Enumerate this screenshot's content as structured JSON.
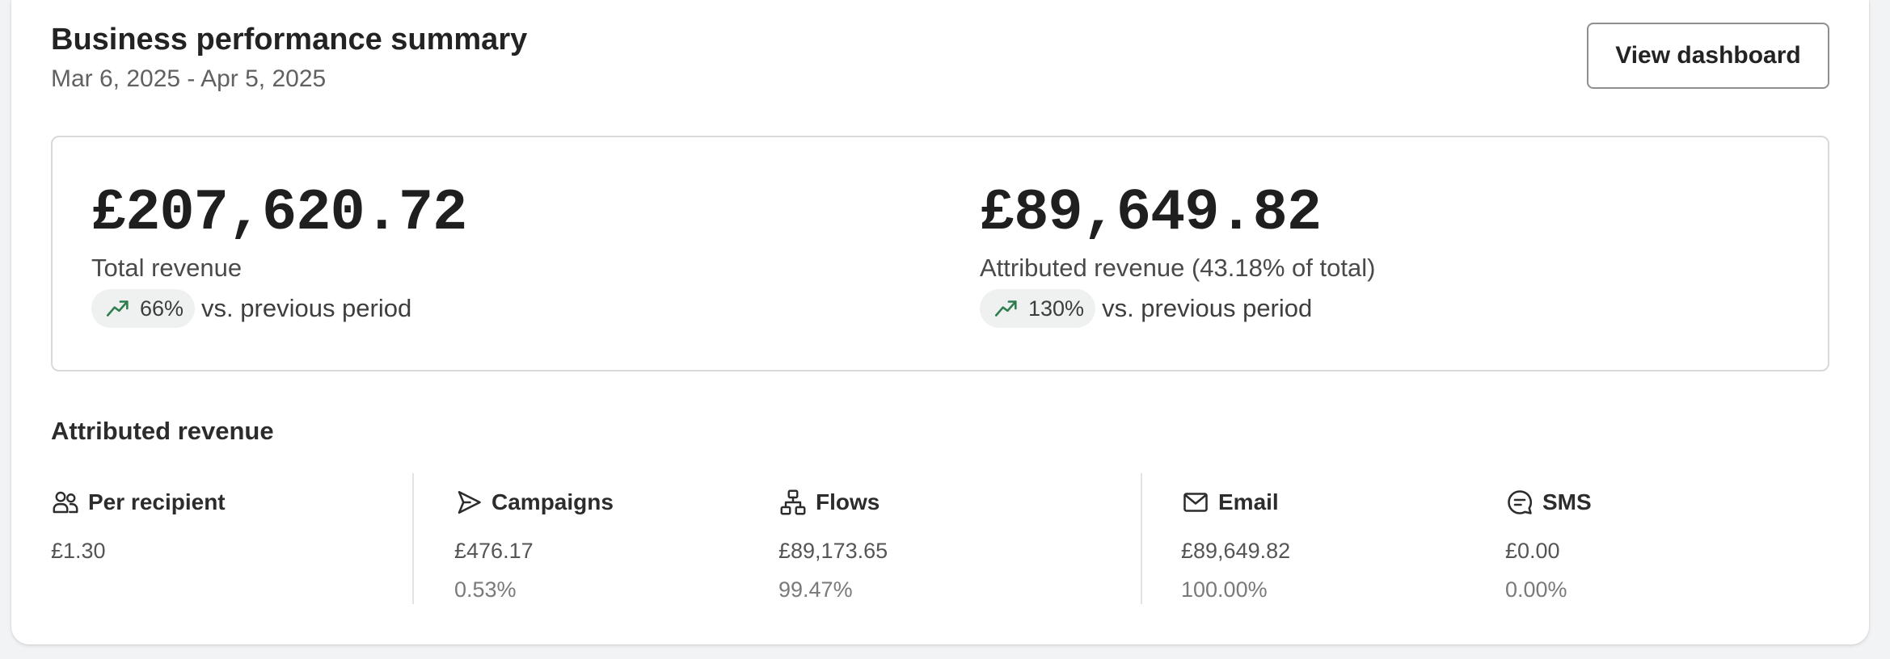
{
  "header": {
    "title": "Business performance summary",
    "date_range": "Mar 6, 2025 - Apr 5, 2025",
    "button_label": "View dashboard"
  },
  "summary": {
    "total": {
      "value": "£207,620.72",
      "label": "Total revenue",
      "change": "66%",
      "comparison": "vs. previous period"
    },
    "attributed": {
      "value": "£89,649.82",
      "label": "Attributed revenue (43.18% of total)",
      "change": "130%",
      "comparison": "vs. previous period"
    }
  },
  "attributed_section": {
    "title": "Attributed revenue",
    "columns": [
      {
        "name": "Per recipient",
        "icon": "users-icon",
        "value": "£1.30",
        "percent": ""
      },
      {
        "name": "Campaigns",
        "icon": "send-icon",
        "value": "£476.17",
        "percent": "0.53%"
      },
      {
        "name": "Flows",
        "icon": "flows-icon",
        "value": "£89,173.65",
        "percent": "99.47%"
      },
      {
        "name": "Email",
        "icon": "mail-icon",
        "value": "£89,649.82",
        "percent": "100.00%"
      },
      {
        "name": "SMS",
        "icon": "sms-icon",
        "value": "£0.00",
        "percent": "0.00%"
      }
    ]
  },
  "colors": {
    "trend_green": "#2e7d4f",
    "pill_bg": "#eef1ef",
    "border": "#d9d9d9"
  }
}
